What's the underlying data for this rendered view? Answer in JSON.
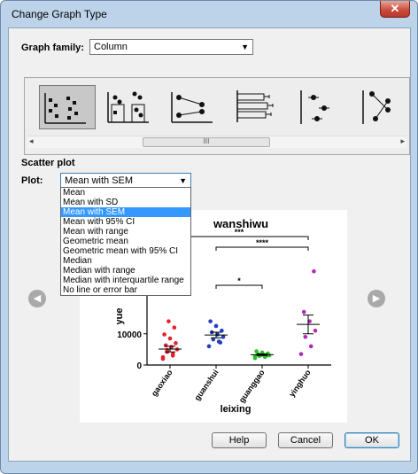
{
  "window": {
    "title": "Change Graph Type",
    "close_glyph": "✕"
  },
  "graph_family": {
    "label": "Graph family:",
    "value": "Column"
  },
  "gallery": {
    "tiles": [
      {
        "icon": "scatter-plot-icon",
        "selected": true
      },
      {
        "icon": "scatter-with-bars-icon",
        "selected": false
      },
      {
        "icon": "before-after-lines-icon",
        "selected": false
      },
      {
        "icon": "horizontal-bars-with-error-icon",
        "selected": false
      },
      {
        "icon": "horizontal-points-with-error-icon",
        "selected": false
      },
      {
        "icon": "connected-points-icon",
        "selected": false
      }
    ],
    "scroll_left": "◂",
    "scroll_right": "▸",
    "thumb_grip": "III"
  },
  "section_title": "Scatter plot",
  "plot": {
    "label": "Plot:",
    "value": "Mean with SEM",
    "options": [
      "Mean",
      "Mean with SD",
      "Mean with SEM",
      "Mean with 95% CI",
      "Mean with range",
      "Geometric mean",
      "Geometric mean with 95% CI",
      "Median",
      "Median with range",
      "Median with interquartile range",
      "No line or error bar"
    ],
    "highlighted_index": 2
  },
  "nav": {
    "prev_glyph": "◀",
    "next_glyph": "▶"
  },
  "chart_data": {
    "type": "scatter",
    "title": "wanshiwu",
    "xlabel": "leixing",
    "ylabel": "yue",
    "categories": [
      "gaoxiao",
      "guanshui",
      "guanggao",
      "yinghuo"
    ],
    "y_ticks": [
      10000,
      0
    ],
    "ylim": [
      0,
      40000
    ],
    "colors": [
      "#e8202a",
      "#1f3fc4",
      "#2dbb2d",
      "#b129b8"
    ],
    "series": [
      {
        "values": [
          2000,
          3500,
          4200,
          5000,
          5800,
          6300,
          7000,
          8500,
          9800,
          12000,
          14000,
          2500,
          3000,
          4800
        ],
        "mean": 5100,
        "sem": 900
      },
      {
        "values": [
          6000,
          7500,
          8200,
          9000,
          9800,
          10500,
          11000,
          12500,
          14000,
          7200
        ],
        "mean": 9600,
        "sem": 900
      },
      {
        "values": [
          2200,
          2600,
          2900,
          3100,
          3300,
          3500,
          3700,
          4000,
          4400,
          3000,
          3200,
          2800
        ],
        "mean": 3300,
        "sem": 250
      },
      {
        "values": [
          3500,
          6000,
          9000,
          11000,
          14000,
          17000,
          30000
        ],
        "mean": 13000,
        "sem": 3000
      }
    ],
    "significance": [
      {
        "from": 0,
        "to": 3,
        "label": "***"
      },
      {
        "from": 1,
        "to": 3,
        "label": "****"
      },
      {
        "from": 1,
        "to": 2,
        "label": "*"
      }
    ]
  },
  "buttons": {
    "help": "Help",
    "cancel": "Cancel",
    "ok": "OK"
  }
}
